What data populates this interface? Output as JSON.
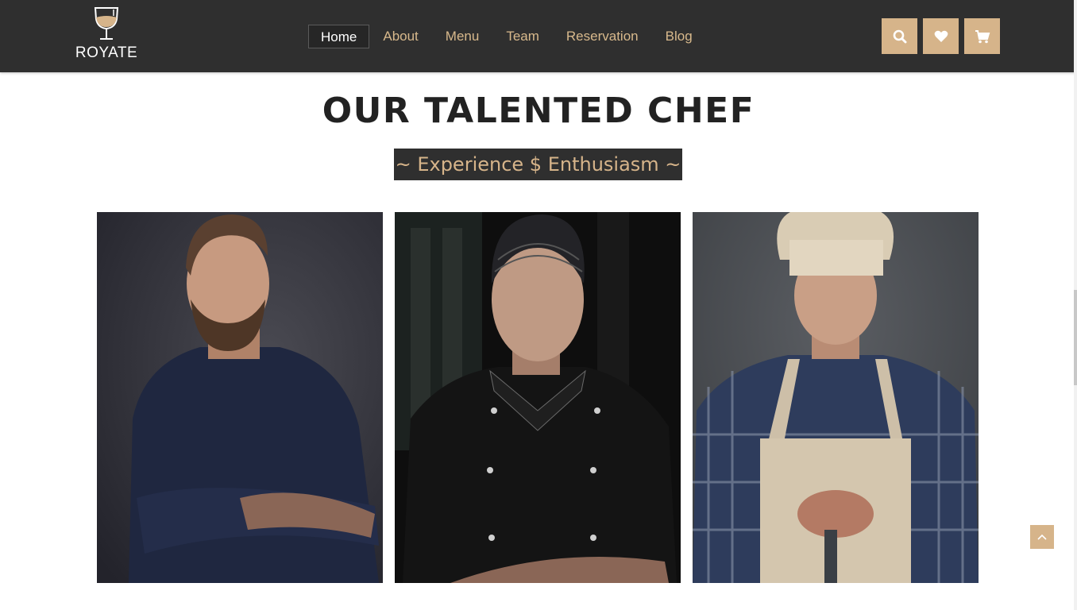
{
  "header": {
    "logo_text": "ROYATE",
    "nav": [
      {
        "label": "Home",
        "active": true
      },
      {
        "label": "About"
      },
      {
        "label": "Menu"
      },
      {
        "label": "Team"
      },
      {
        "label": "Reservation"
      },
      {
        "label": "Blog"
      }
    ],
    "icons": [
      "search-icon",
      "heart-icon",
      "cart-icon"
    ]
  },
  "section": {
    "title": "OUR TALENTED CHEF",
    "subtitle": "~ Experience $ Enthusiasm ~"
  },
  "chefs": [
    {
      "photo": "chef-photo-bearded-dark-shirt"
    },
    {
      "photo": "chef-photo-black-uniform"
    },
    {
      "photo": "chef-photo-white-hat-apron"
    }
  ],
  "colors": {
    "header_bg": "#2f2f2f",
    "accent": "#d6b48a",
    "title": "#222222"
  }
}
